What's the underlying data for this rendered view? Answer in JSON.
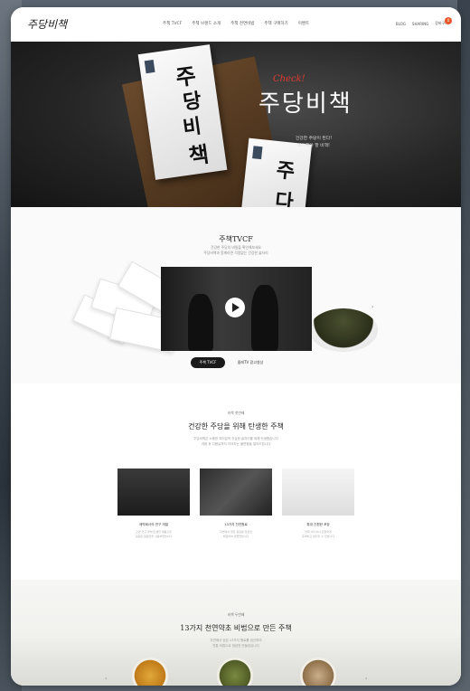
{
  "header": {
    "logo": "주당비책",
    "nav": [
      "주책 TVCF",
      "주책 브랜드 소개",
      "주책 천연비법",
      "주책 구매하기",
      "이벤트"
    ],
    "util": [
      "BLOG",
      "SHARING",
      "장바구니"
    ],
    "cart_count": "0"
  },
  "hero": {
    "box_chars": [
      "주",
      "당",
      "비",
      "책"
    ],
    "check": "Check!",
    "title": "주당비책",
    "subtitle_lines": [
      "건강한 주당이 된다!",
      "체크해야 할 비책!"
    ],
    "box2_chars": [
      "주",
      "다"
    ]
  },
  "tvcf": {
    "title": "주책TVCF",
    "sub_lines": [
      "건강한 주당의 비밀을 확인해보세요",
      "주당비책과 함께라면 걱정없는 건강한 술자리"
    ],
    "tab_active": "주책 TVCF",
    "tab_other": "올레TV 광고영상",
    "next_arrow": "›"
  },
  "section3": {
    "label": "비책 첫번째",
    "title": "건강한 주당을 위해 탄생한 주책",
    "desc_lines": [
      "주당비책은 소중한 여러분의 건강한 술자리를 위해 탄생했습니다",
      "과음 후 다음날까지 이어지는 불편함을 덜어드립니다"
    ],
    "cards": [
      {
        "title": "제약회사의 연구 개발",
        "desc": [
          "오랜 연구 끝에 탄생한 제품으로",
          "검증된 원료만을 사용하였습니다"
        ]
      },
      {
        "title": "13가지 천연원료",
        "desc": [
          "자연에서 얻은 원료를 정성껏",
          "배합하여 만들었습니다"
        ]
      },
      {
        "title": "휴대 간편한 포장",
        "desc": [
          "언제 어디서나 간편하게",
          "휴대하고 섭취할 수 있습니다"
        ]
      }
    ]
  },
  "section4": {
    "label": "비책 두번째",
    "title": "13가지 천연약초 비법으로 만든 주책",
    "desc_lines": [
      "자연에서 얻은 13가지 원료를 엄선하여",
      "전통 비법으로 정성껏 만들었습니다"
    ],
    "prev_arrow": "‹",
    "next_arrow": "›"
  }
}
